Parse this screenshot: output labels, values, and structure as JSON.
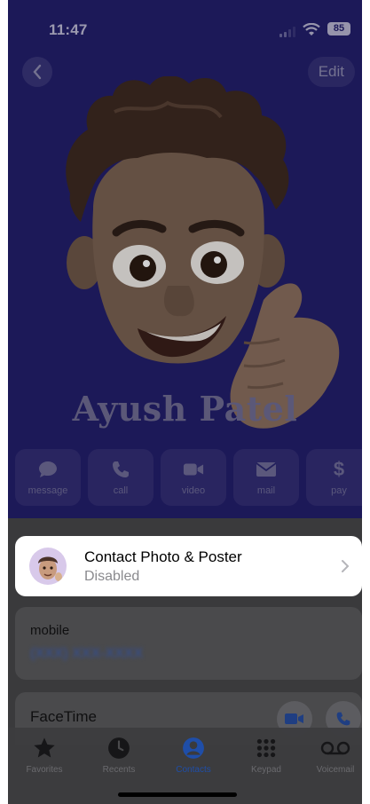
{
  "status": {
    "time": "11:47",
    "battery": "85"
  },
  "nav": {
    "edit_label": "Edit"
  },
  "contact": {
    "name": "Ayush Patel"
  },
  "actions": [
    {
      "label": "message",
      "icon": "message-bubble-icon"
    },
    {
      "label": "call",
      "icon": "phone-icon"
    },
    {
      "label": "video",
      "icon": "video-camera-icon"
    },
    {
      "label": "mail",
      "icon": "envelope-icon"
    },
    {
      "label": "pay",
      "icon": "dollar-icon"
    }
  ],
  "poster_card": {
    "title": "Contact Photo & Poster",
    "status": "Disabled"
  },
  "mobile": {
    "label": "mobile",
    "number": "(XXX) XXX-XXXX"
  },
  "facetime": {
    "label": "FaceTime"
  },
  "tabs": [
    {
      "label": "Favorites",
      "icon": "star-icon"
    },
    {
      "label": "Recents",
      "icon": "clock-icon"
    },
    {
      "label": "Contacts",
      "icon": "person-circle-icon",
      "active": true
    },
    {
      "label": "Keypad",
      "icon": "keypad-icon"
    },
    {
      "label": "Voicemail",
      "icon": "voicemail-icon"
    }
  ],
  "colors": {
    "poster_bg": "#231f6c",
    "accent": "#1f4ea8",
    "sheet": "#3a3a3c"
  }
}
